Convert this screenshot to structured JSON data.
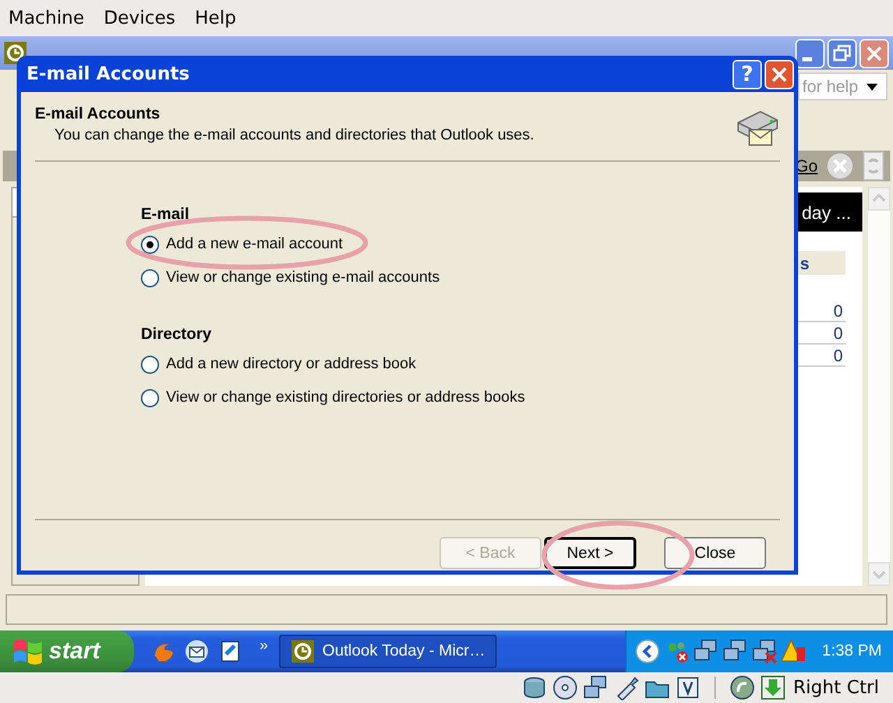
{
  "vm_menu": [
    {
      "label": "Machine"
    },
    {
      "label": "Devices"
    },
    {
      "label": "Help"
    }
  ],
  "outlook": {
    "help_field": {
      "placeholder": "for help"
    },
    "go": "Go",
    "header": "day ...",
    "subheader": "s",
    "rows": [
      "0",
      "0",
      "0"
    ]
  },
  "dialog": {
    "title": "E-mail Accounts",
    "help_button": "?",
    "heading": "E-mail Accounts",
    "description": "You can change the e-mail accounts and directories that Outlook uses.",
    "groups": [
      {
        "title": "E-mail",
        "options": [
          {
            "label": "Add a new e-mail account",
            "selected": true
          },
          {
            "label": "View or change existing e-mail accounts",
            "selected": false
          }
        ]
      },
      {
        "title": "Directory",
        "options": [
          {
            "label": "Add a new directory or address book",
            "selected": false
          },
          {
            "label": "View or change existing directories or address books",
            "selected": false
          }
        ]
      }
    ],
    "buttons": [
      {
        "label": "< Back",
        "disabled": true,
        "default": false
      },
      {
        "label": "Next >",
        "disabled": false,
        "default": true
      },
      {
        "label": "Close",
        "disabled": false,
        "default": false
      }
    ]
  },
  "taskbar": {
    "start": "start",
    "overflow": "»",
    "tasks": [
      {
        "label": "Outlook Today - Micr…"
      }
    ],
    "clock": "1:38 PM"
  },
  "vm_status": {
    "host_key": "Right Ctrl"
  }
}
